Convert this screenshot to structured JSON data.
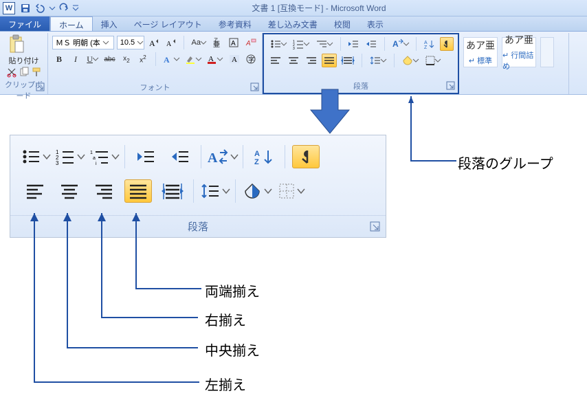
{
  "title": "文書 1 [互換モード] - Microsoft Word",
  "word_icon_letter": "W",
  "tabs": {
    "file": "ファイル",
    "home": "ホーム",
    "insert": "挿入",
    "pagelayout": "ページ レイアウト",
    "references": "参考資料",
    "mailings": "差し込み文書",
    "review": "校閲",
    "view": "表示"
  },
  "clipboard": {
    "paste": "貼り付け",
    "group_label": "クリップボード"
  },
  "font": {
    "name": "ＭＳ 明朝 (本",
    "size": "10.5",
    "group_label": "フォント",
    "bold": "B",
    "italic": "I",
    "underline": "U",
    "strike": "abc",
    "sub": "x₂",
    "sup": "x²",
    "fontcolor": "A",
    "charshade": "A",
    "ruby": "ᴬ⁄ₐ",
    "enclose": "㊉",
    "clear": "Aa"
  },
  "paragraph": {
    "group_label": "段落"
  },
  "styles": {
    "sample": "あア亜",
    "normal": "↵ 標準",
    "nospace": "↵ 行間詰め"
  },
  "callouts": {
    "group": "段落のグループ",
    "justify": "両端揃え",
    "right": "右揃え",
    "center": "中央揃え",
    "left": "左揃え"
  },
  "zoom_group_label": "段落"
}
